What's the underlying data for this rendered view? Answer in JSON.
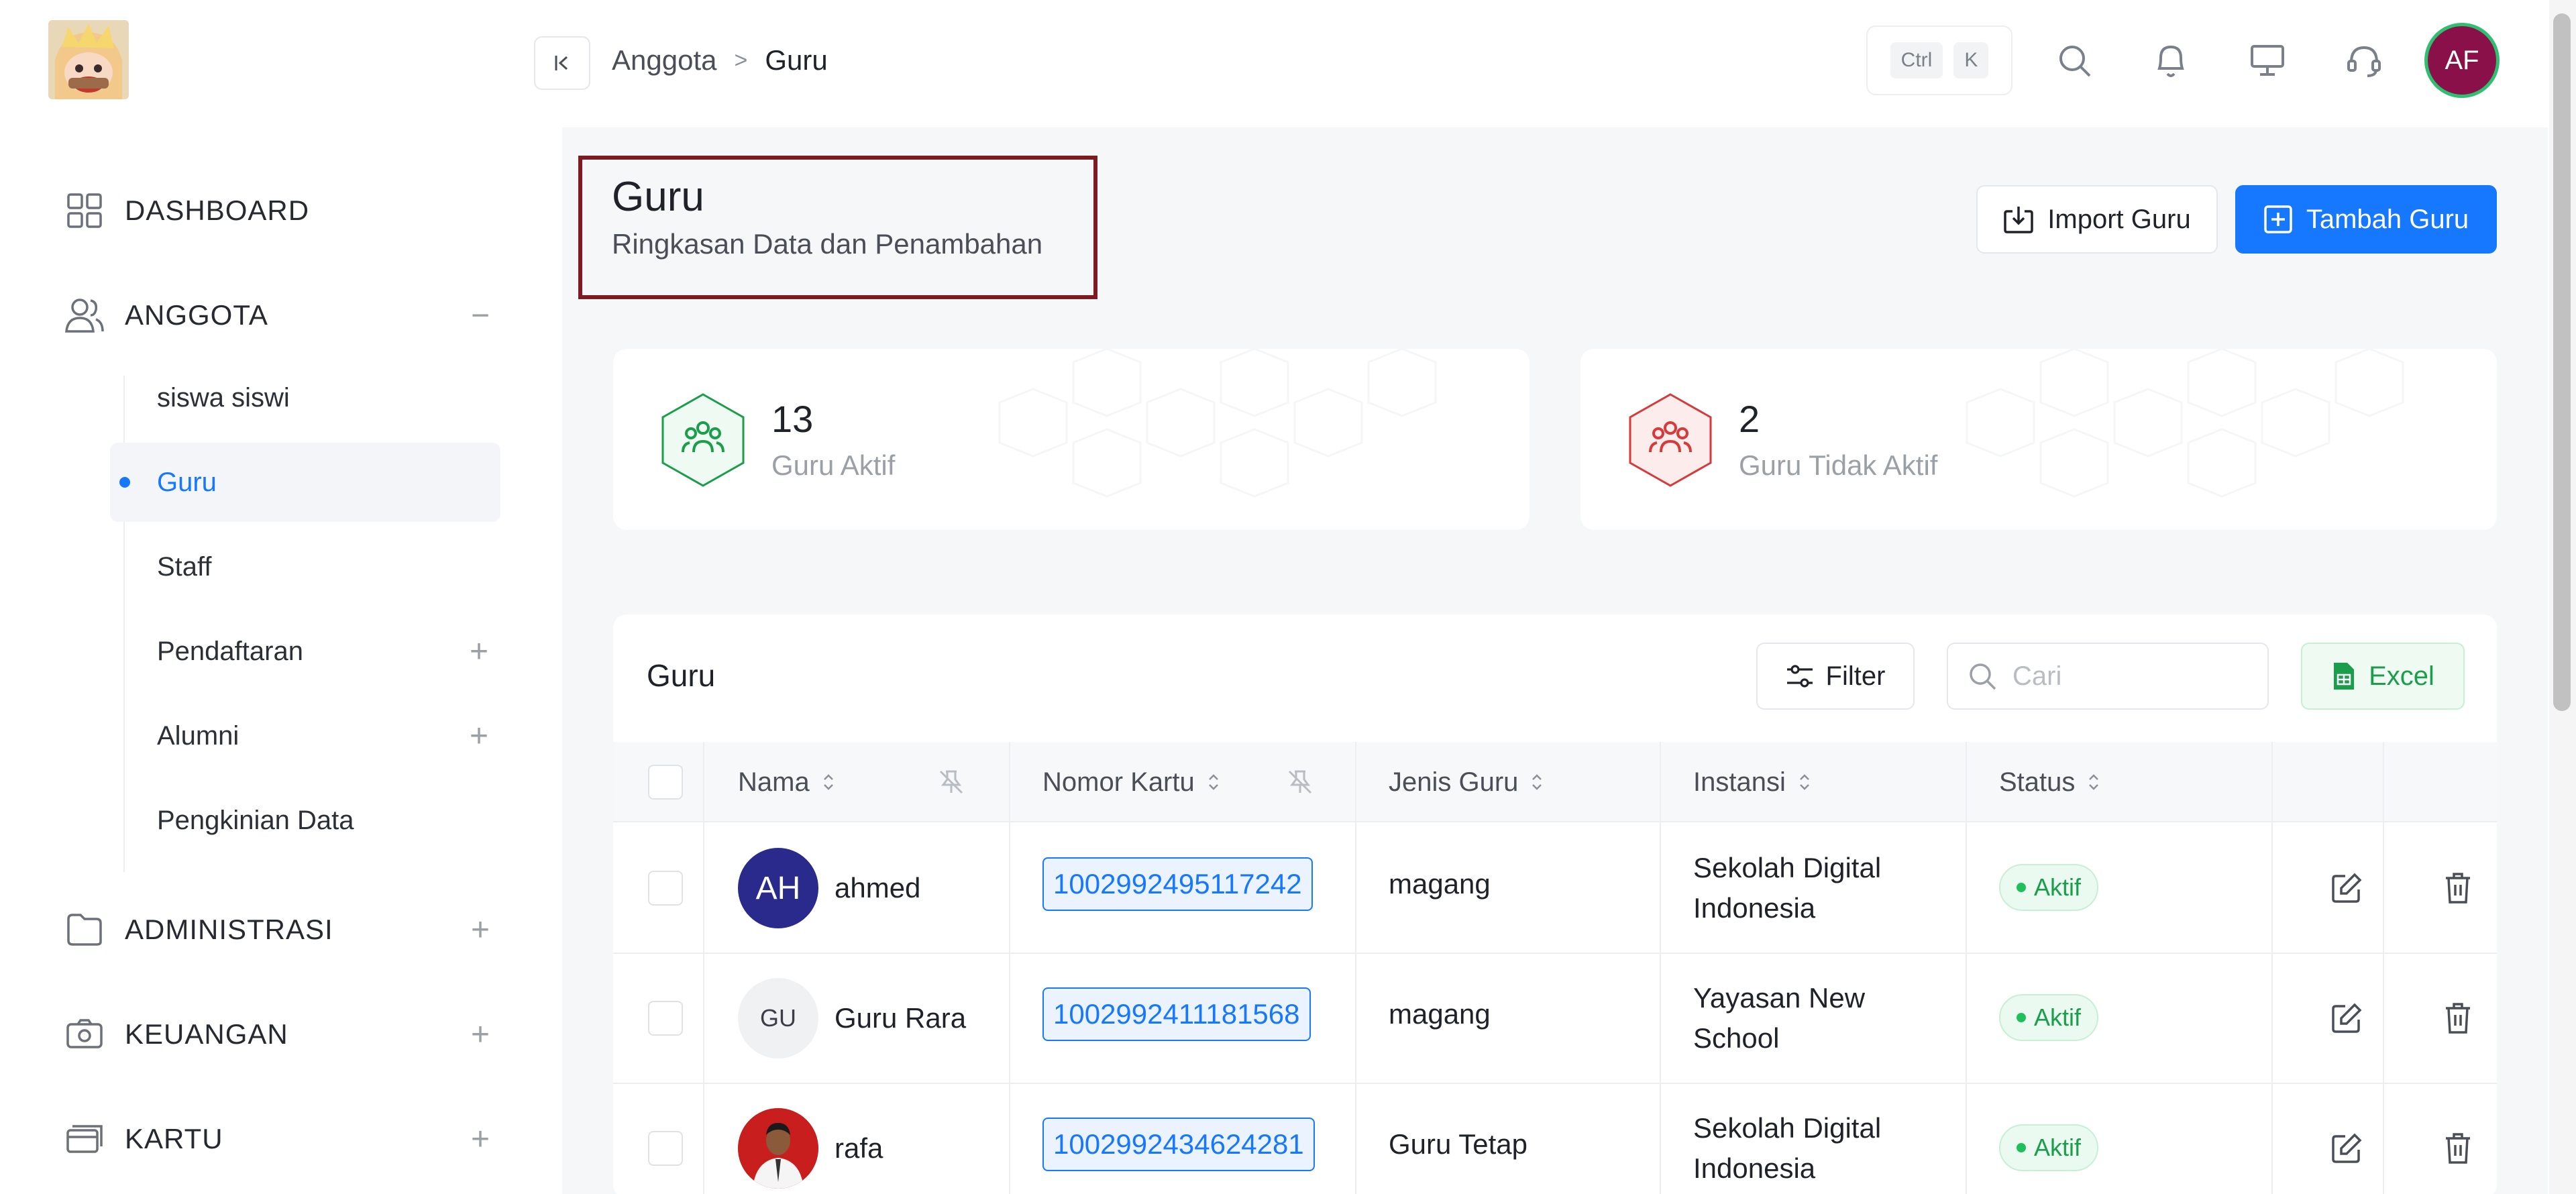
{
  "sidebar": {
    "items": [
      {
        "label": "DASHBOARD",
        "icon": "grid-icon"
      },
      {
        "label": "ANGGOTA",
        "icon": "users-icon",
        "control": "−"
      },
      {
        "label": "ADMINISTRASI",
        "icon": "folder-icon",
        "control": "+"
      },
      {
        "label": "KEUANGAN",
        "icon": "camera-icon",
        "control": "+"
      },
      {
        "label": "KARTU",
        "icon": "card-icon",
        "control": "+"
      }
    ],
    "sub_items": [
      {
        "label": "siswa siswi"
      },
      {
        "label": "Guru",
        "active": true
      },
      {
        "label": "Staff"
      },
      {
        "label": "Pendaftaran",
        "control": "+"
      },
      {
        "label": "Alumni",
        "control": "+"
      },
      {
        "label": "Pengkinian Data"
      }
    ]
  },
  "header": {
    "breadcrumb": [
      "Anggota",
      "Guru"
    ],
    "breadcrumb_sep": ">",
    "shortcut": [
      "Ctrl",
      "K"
    ],
    "icons": [
      "search-icon",
      "bell-icon",
      "monitor-icon",
      "headset-icon"
    ],
    "avatar_initials": "AF",
    "avatar_color": "#8a1049"
  },
  "page": {
    "title": "Guru",
    "subtitle": "Ringkasan Data dan Penambahan",
    "import_label": "Import Guru",
    "add_label": "Tambah Guru",
    "accent": "#1677ff"
  },
  "stats": [
    {
      "value": "13",
      "label": "Guru Aktif",
      "color": "#1b9e4b"
    },
    {
      "value": "2",
      "label": "Guru Tidak Aktif",
      "color": "#d63a3a"
    }
  ],
  "table": {
    "title": "Guru",
    "filter_label": "Filter",
    "search_placeholder": "Cari",
    "excel_label": "Excel",
    "columns": [
      "Nama",
      "Nomor Kartu",
      "Jenis Guru",
      "Instansi",
      "Status"
    ],
    "rows": [
      {
        "avatar": "AH",
        "avatar_color": "#2a2a8c",
        "name": "ahmed",
        "card": "1002992495117242",
        "jenis": "magang",
        "instansi_1": "Sekolah Digital",
        "instansi_2": "Indonesia",
        "status": "Aktif"
      },
      {
        "avatar": "GU",
        "avatar_color": "#f0f1f3",
        "name": "Guru Rara",
        "card": "1002992411181568",
        "jenis": "magang",
        "instansi_1": "Yayasan New",
        "instansi_2": "School",
        "status": "Aktif"
      },
      {
        "avatar": "",
        "avatar_color": "#c81e1e",
        "name": "rafa",
        "card": "1002992434624281",
        "jenis": "Guru Tetap",
        "instansi_1": "Sekolah Digital",
        "instansi_2": "Indonesia",
        "status": "Aktif"
      }
    ]
  }
}
